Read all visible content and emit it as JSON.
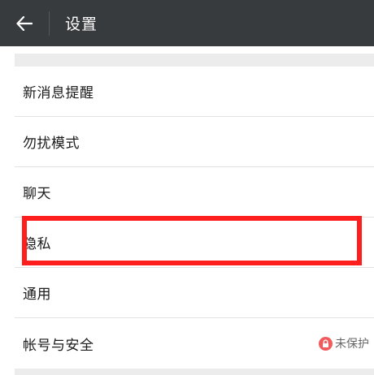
{
  "header": {
    "back_icon": "arrow-left-icon",
    "title": "设置"
  },
  "settings": {
    "items": [
      {
        "label": "新消息提醒"
      },
      {
        "label": "勿扰模式"
      },
      {
        "label": "聊天"
      },
      {
        "label": "隐私"
      },
      {
        "label": "通用"
      },
      {
        "label": "帐号与安全",
        "status": "未保护",
        "status_icon": "lock-icon"
      }
    ]
  },
  "colors": {
    "header_bg": "#373b3e",
    "highlight": "#ff1e1e",
    "status_icon": "#f25b5b"
  }
}
